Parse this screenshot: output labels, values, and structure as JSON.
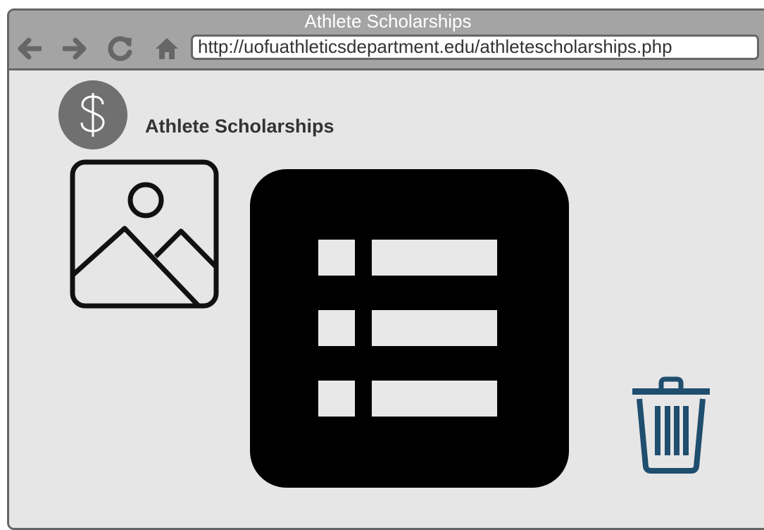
{
  "window": {
    "title": "Athlete Scholarships"
  },
  "toolbar": {
    "url": "http://uofuathleticsdepartment.edu/athletescholarships.php",
    "icons": [
      "back-arrow-icon",
      "forward-arrow-icon",
      "reload-icon",
      "home-icon"
    ]
  },
  "header": {
    "avatar_icon": "dollar-sign-icon",
    "title": "Athlete Scholarships"
  },
  "main": {
    "image_icon": "image-placeholder-icon",
    "list_icon": "list-icon",
    "delete_icon": "trash-icon"
  },
  "colors": {
    "chrome": "#a4a4a4",
    "border": "#666666",
    "background": "#e6e6e6",
    "avatar": "#707070",
    "trash": "#1f4e6e"
  }
}
